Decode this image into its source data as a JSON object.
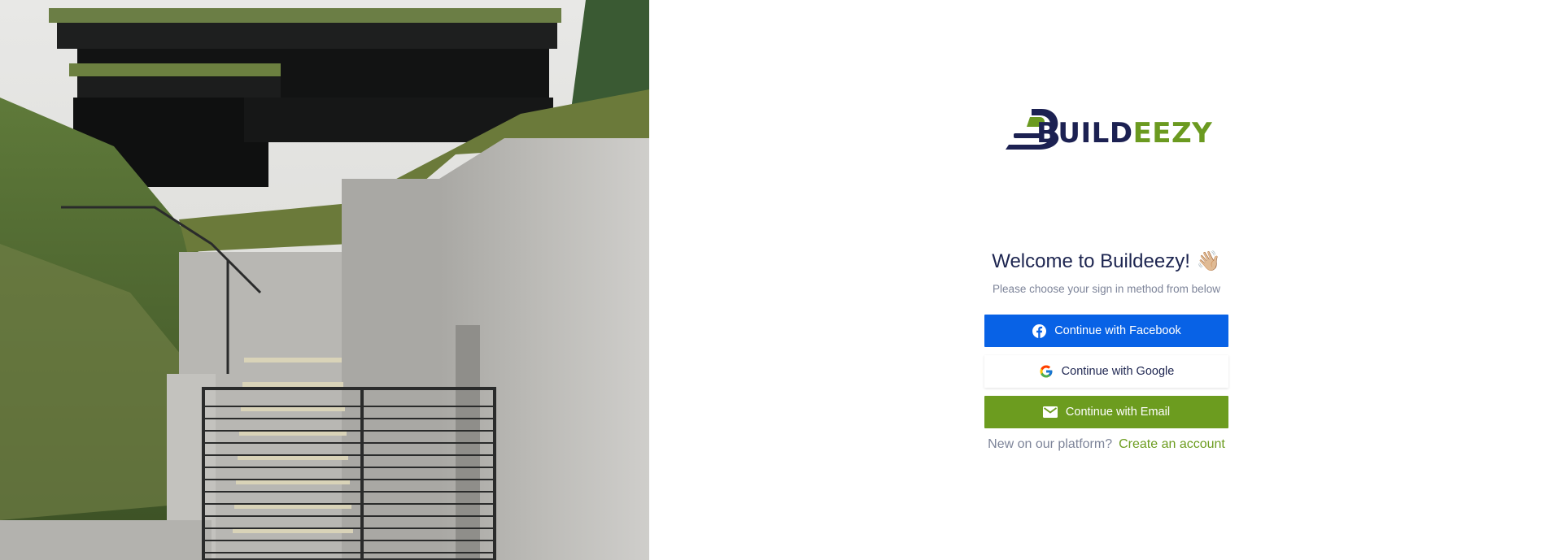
{
  "brand": {
    "logo_part1": "BUILD",
    "logo_part2": "EEZY",
    "primary_color": "#1c2152",
    "accent_color": "#6b9a20"
  },
  "hero": {
    "description_icon": "building-photo"
  },
  "signin": {
    "title": "Welcome to Buildeezy!",
    "title_emoji": "👋🏼",
    "subtitle": "Please choose your sign in method from below",
    "buttons": {
      "facebook": {
        "label": "Continue with Facebook",
        "icon": "facebook-icon",
        "color": "#0862e6"
      },
      "google": {
        "label": "Continue with Google",
        "icon": "google-icon",
        "color": "#ffffff"
      },
      "email": {
        "label": "Continue with Email",
        "icon": "mail-icon",
        "color": "#6c9c1f"
      }
    },
    "footer": {
      "prompt": "New on our platform?",
      "link": "Create an account"
    }
  }
}
